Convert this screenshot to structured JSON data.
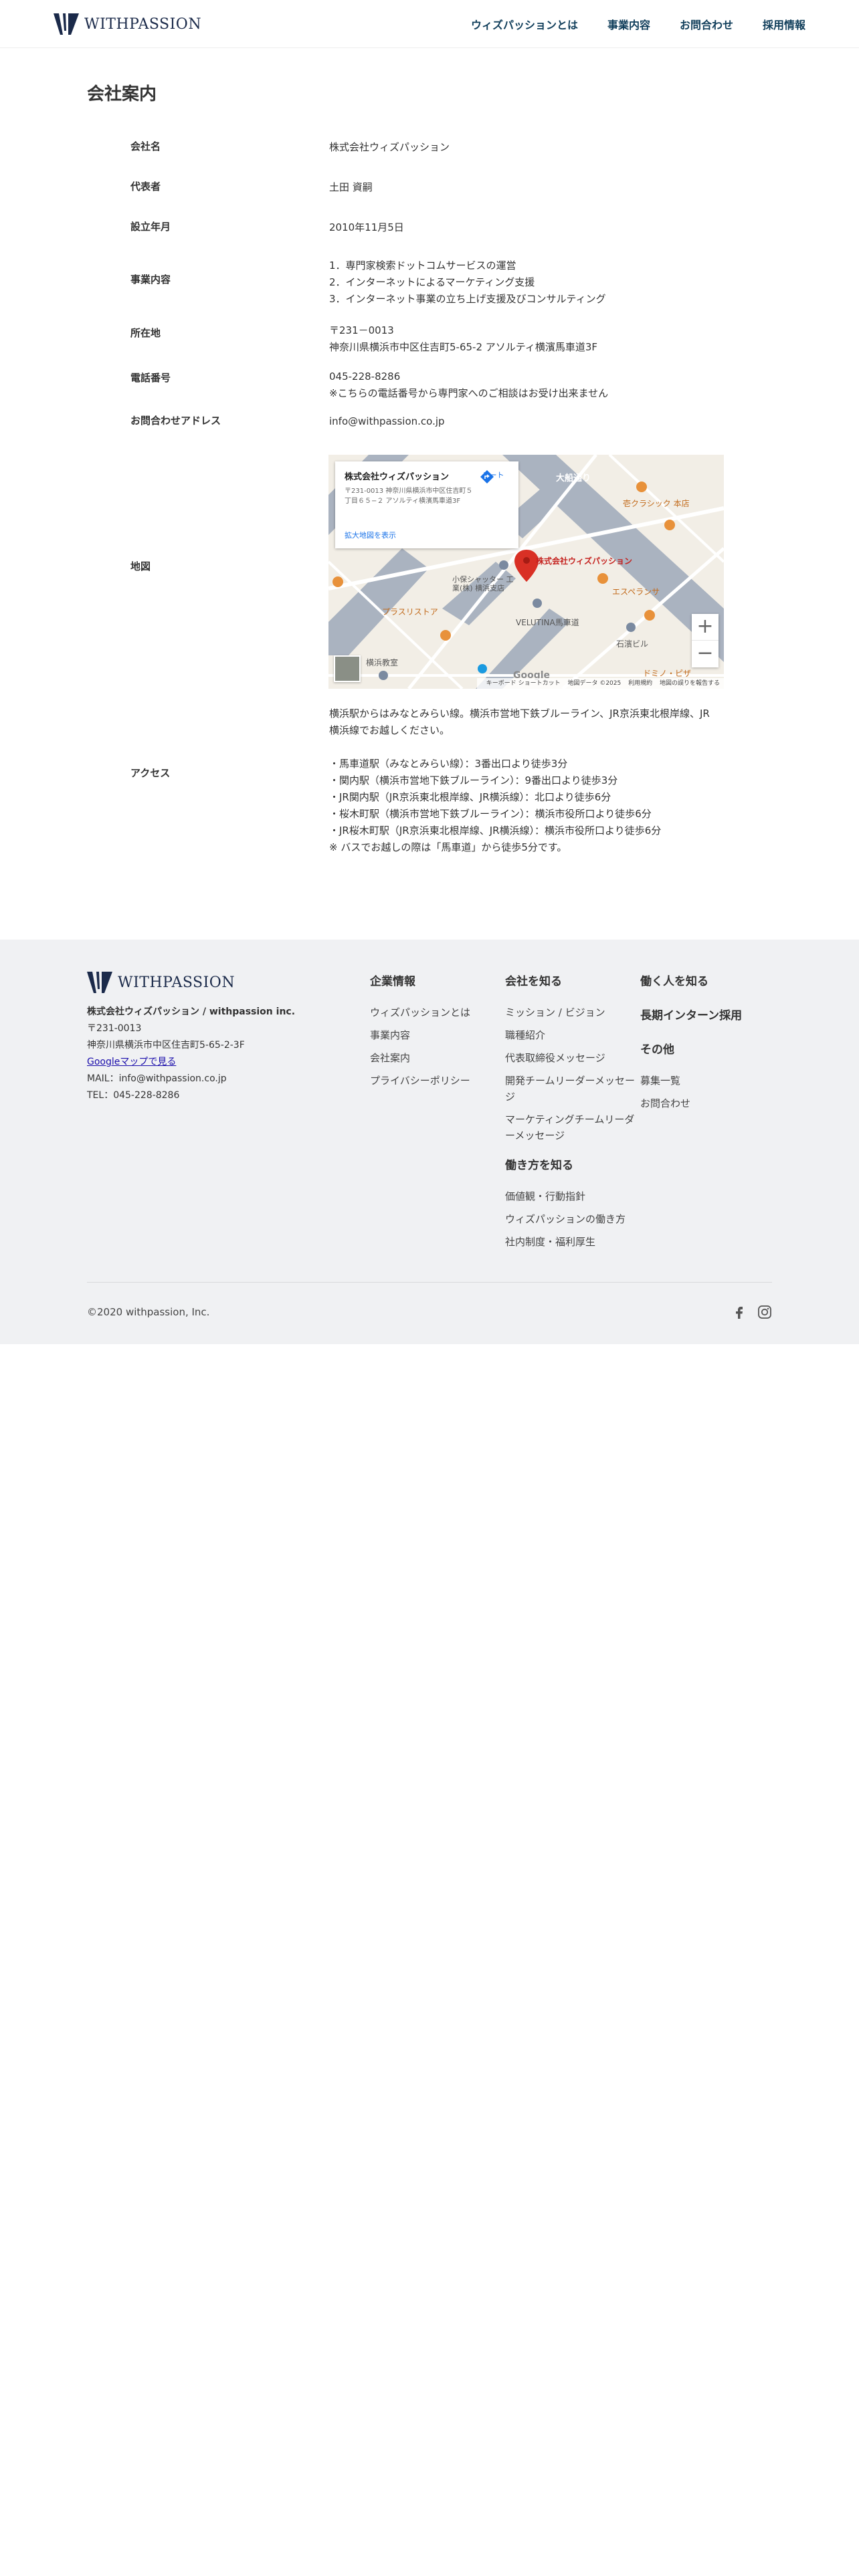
{
  "header": {
    "logo_text": "WITHPASSION",
    "nav": [
      "ウィズパッションとは",
      "事業内容",
      "お問合わせ",
      "採用情報"
    ]
  },
  "page_title": "会社案内",
  "company": {
    "name_label": "会社名",
    "name_value": "株式会社ウィズパッション",
    "rep_label": "代表者",
    "rep_value": "土田 資嗣",
    "founded_label": "設立年月",
    "founded_value": "2010年11月5日",
    "business_label": "事業内容",
    "business_items": [
      "1．専門家検索ドットコムサービスの運営",
      "2．インターネットによるマーケティング支援",
      "3．インターネット事業の立ち上げ支援及びコンサルティング"
    ],
    "address_label": "所在地",
    "address_zip": "〒231－0013",
    "address_value": "神奈川県横浜市中区住吉町5-65-2 アソルティ横濱馬車道3F",
    "phone_label": "電話番号",
    "phone_value": "045-228-8286",
    "phone_note": "※こちらの電話番号から専門家へのご相談はお受け出来ません",
    "email_label": "お問合わせアドレス",
    "email_value": "info@withpassion.co.jp",
    "map_label": "地図",
    "access_label": "アクセス",
    "access_intro": "横浜駅からはみなとみらい線。横浜市営地下鉄ブルーライン、JR京浜東北根岸線、JR横浜線でお越しください。",
    "access_items": [
      "・馬車道駅（みなとみらい線）：3番出口より徒歩3分",
      "・関内駅（横浜市営地下鉄ブルーライン）：9番出口より徒歩3分",
      "・JR関内駅（JR京浜東北根岸線、JR横浜線）：北口より徒歩6分",
      "・桜木町駅（横浜市営地下鉄ブルーライン）：横浜市役所口より徒歩6分",
      "・JR桜木町駅（JR京浜東北根岸線、JR横浜線）：横浜市役所口より徒歩6分",
      "※ バスでお越しの際は「馬車道」から徒歩5分です。"
    ]
  },
  "map": {
    "card_title": "株式会社ウィズパッション",
    "card_address": "〒231-0013 神奈川県横浜市中区住吉町５丁目６５−２ アソルティ横濱馬車道3F",
    "card_link": "拡大地図を表示",
    "route_label": "ルート",
    "marker_label": "株式会社ウィズパッション",
    "labels": {
      "road": "大船通り",
      "shop1": "壱クラシック 本店",
      "shop2": "エスペランサ",
      "bank1": "小保シャッター 工業(株) 横浜支店",
      "bank2": "VELUTINA馬車道",
      "bldg": "石濱ビル",
      "plus": "プラスリストア",
      "park": "横浜教室",
      "dom": "ドミノ・ピザ"
    },
    "zoom_in": "+",
    "zoom_out": "−",
    "google": "Google",
    "attrib": [
      "キーボード ショートカット",
      "地図データ ©2025",
      "利用規約",
      "地図の誤りを報告する"
    ]
  },
  "footer": {
    "logo_text": "WITHPASSION",
    "company_name": "株式会社ウィズパッション / withpassion inc.",
    "zip": "〒231-0013",
    "address": "神奈川県横浜市中区住吉町5-65-2-3F",
    "map_link": "Googleマップで見る",
    "mail": "MAIL：info@withpassion.co.jp",
    "tel": "TEL：045-228-8286",
    "col1": {
      "head": "企業情報",
      "items": [
        "ウィズパッションとは",
        "事業内容",
        "会社案内",
        "プライバシーポリシー"
      ]
    },
    "col2": {
      "head": "会社を知る",
      "items": [
        "ミッション / ビジョン",
        "職種紹介",
        "代表取締役メッセージ",
        "開発チームリーダーメッセージ",
        "マーケティングチームリーダーメッセージ"
      ],
      "head2": "働き方を知る",
      "items2": [
        "価値観・行動指針",
        "ウィズパッションの働き方",
        "社内制度・福利厚生"
      ]
    },
    "col3": {
      "head": "働く人を知る",
      "head2": "長期インターン採用",
      "head3": "その他",
      "items3": [
        "募集一覧",
        "お問合わせ"
      ]
    },
    "copyright": "©2020 withpassion, Inc."
  },
  "colors": {
    "nav": "#0f3d5a",
    "footer_bg": "#f0f1f3",
    "marker": "#d93025",
    "link": "#1a73e8"
  }
}
